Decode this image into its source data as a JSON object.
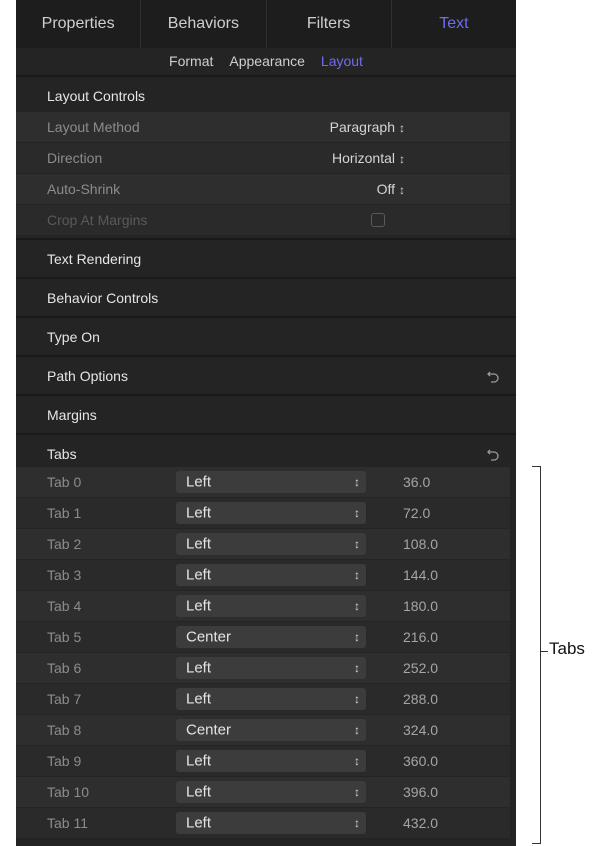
{
  "tabs": [
    {
      "label": "Properties"
    },
    {
      "label": "Behaviors"
    },
    {
      "label": "Filters"
    },
    {
      "label": "Text",
      "active": true
    }
  ],
  "subtabs": [
    {
      "label": "Format"
    },
    {
      "label": "Appearance"
    },
    {
      "label": "Layout",
      "active": true
    }
  ],
  "sections": {
    "layout_controls": "Layout Controls",
    "text_rendering": "Text Rendering",
    "behavior_controls": "Behavior Controls",
    "type_on": "Type On",
    "path_options": "Path Options",
    "margins": "Margins",
    "tabs": "Tabs"
  },
  "layout_controls": {
    "layout_method": {
      "label": "Layout Method",
      "value": "Paragraph"
    },
    "direction": {
      "label": "Direction",
      "value": "Horizontal"
    },
    "auto_shrink": {
      "label": "Auto-Shrink",
      "value": "Off"
    },
    "crop_at_margins": {
      "label": "Crop At Margins",
      "checked": false
    }
  },
  "tab_rows": [
    {
      "label": "Tab 0",
      "align": "Left",
      "value": "36.0"
    },
    {
      "label": "Tab 1",
      "align": "Left",
      "value": "72.0"
    },
    {
      "label": "Tab 2",
      "align": "Left",
      "value": "108.0"
    },
    {
      "label": "Tab 3",
      "align": "Left",
      "value": "144.0"
    },
    {
      "label": "Tab 4",
      "align": "Left",
      "value": "180.0"
    },
    {
      "label": "Tab 5",
      "align": "Center",
      "value": "216.0"
    },
    {
      "label": "Tab 6",
      "align": "Left",
      "value": "252.0"
    },
    {
      "label": "Tab 7",
      "align": "Left",
      "value": "288.0"
    },
    {
      "label": "Tab 8",
      "align": "Center",
      "value": "324.0"
    },
    {
      "label": "Tab 9",
      "align": "Left",
      "value": "360.0"
    },
    {
      "label": "Tab 10",
      "align": "Left",
      "value": "396.0"
    },
    {
      "label": "Tab 11",
      "align": "Left",
      "value": "432.0"
    }
  ],
  "callout": "Tabs",
  "colors": {
    "accent": "#6f6cf0",
    "panel_bg": "#242424"
  },
  "icons": {
    "stepper": "up-down-chevron-icon",
    "reset": "reset-arrow-icon"
  }
}
